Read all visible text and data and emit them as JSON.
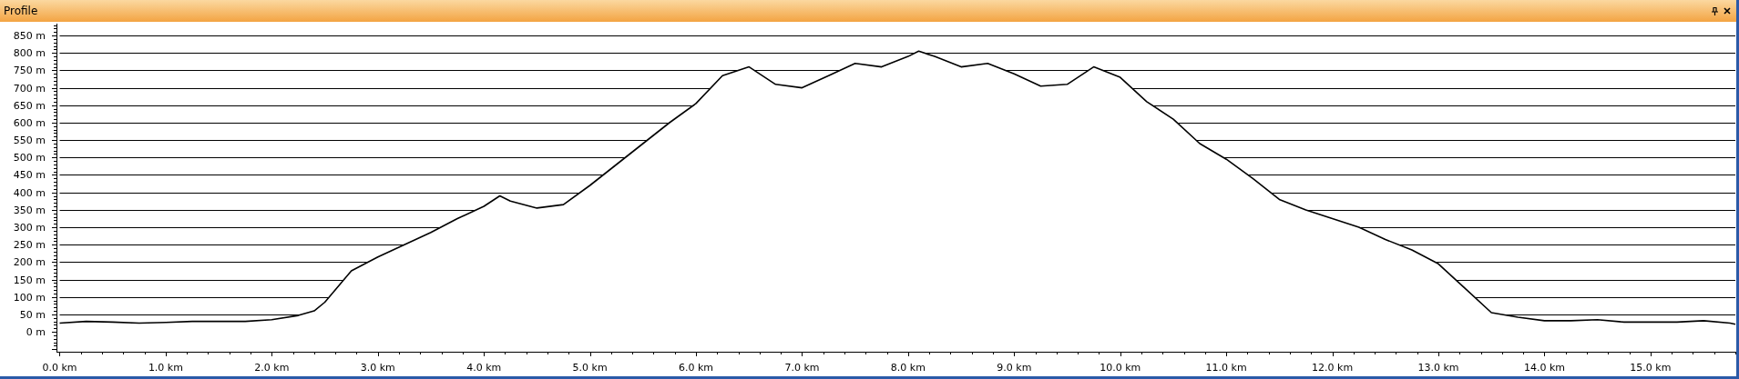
{
  "panel": {
    "title": "Profile"
  },
  "chart": {
    "chart_data": {
      "type": "line",
      "grid": true,
      "xlim": [
        -0.03,
        15.8
      ],
      "ylim": [
        -57,
        884
      ],
      "x": [
        0,
        0.25,
        0.5,
        0.75,
        1,
        1.25,
        1.5,
        1.75,
        2,
        2.25,
        2.4,
        2.5,
        2.75,
        3,
        3.25,
        3.5,
        3.75,
        4,
        4.15,
        4.25,
        4.5,
        4.75,
        5,
        5.25,
        5.5,
        5.75,
        6,
        6.25,
        6.5,
        6.75,
        7,
        7.25,
        7.5,
        7.75,
        8,
        8.1,
        8.25,
        8.5,
        8.75,
        9,
        9.25,
        9.5,
        9.75,
        10,
        10.25,
        10.5,
        10.75,
        11,
        11.25,
        11.5,
        11.75,
        12,
        12.25,
        12.5,
        12.75,
        13,
        13.25,
        13.5,
        13.75,
        14,
        14.25,
        14.5,
        14.75,
        15,
        15.25,
        15.5,
        15.75,
        15.8
      ],
      "series": [
        {
          "color": "#000000",
          "values": [
            25,
            30,
            28,
            25,
            27,
            30,
            30,
            30,
            35,
            47,
            60,
            85,
            175,
            215,
            250,
            285,
            325,
            360,
            390,
            375,
            355,
            365,
            420,
            480,
            540,
            600,
            655,
            735,
            760,
            710,
            700,
            735,
            770,
            760,
            790,
            805,
            790,
            760,
            770,
            740,
            705,
            710,
            760,
            730,
            660,
            610,
            540,
            495,
            440,
            380,
            350,
            325,
            300,
            265,
            235,
            195,
            125,
            55,
            42,
            32,
            32,
            35,
            28,
            28,
            28,
            32,
            25,
            22
          ]
        }
      ],
      "xticks": [
        {
          "value": 0,
          "label": "0.0 km"
        },
        {
          "value": 1,
          "label": "1.0 km"
        },
        {
          "value": 2,
          "label": "2.0 km"
        },
        {
          "value": 3,
          "label": "3.0 km"
        },
        {
          "value": 4,
          "label": "4.0 km"
        },
        {
          "value": 5,
          "label": "5.0 km"
        },
        {
          "value": 6,
          "label": "6.0 km"
        },
        {
          "value": 7,
          "label": "7.0 km"
        },
        {
          "value": 8,
          "label": "8.0 km"
        },
        {
          "value": 9,
          "label": "9.0 km"
        },
        {
          "value": 10,
          "label": "10.0 km"
        },
        {
          "value": 11,
          "label": "11.0 km"
        },
        {
          "value": 12,
          "label": "12.0 km"
        },
        {
          "value": 13,
          "label": "13.0 km"
        },
        {
          "value": 14,
          "label": "14.0 km"
        },
        {
          "value": 15,
          "label": "15.0 km"
        }
      ],
      "yticks": [
        {
          "value": 0,
          "label": "0 m"
        },
        {
          "value": 50,
          "label": "50 m"
        },
        {
          "value": 100,
          "label": "100 m"
        },
        {
          "value": 150,
          "label": "150 m"
        },
        {
          "value": 200,
          "label": "200 m"
        },
        {
          "value": 250,
          "label": "250 m"
        },
        {
          "value": 300,
          "label": "300 m"
        },
        {
          "value": 350,
          "label": "350 m"
        },
        {
          "value": 400,
          "label": "400 m"
        },
        {
          "value": 450,
          "label": "450 m"
        },
        {
          "value": 500,
          "label": "500 m"
        },
        {
          "value": 550,
          "label": "550 m"
        },
        {
          "value": 600,
          "label": "600 m"
        },
        {
          "value": 650,
          "label": "650 m"
        },
        {
          "value": 700,
          "label": "700 m"
        },
        {
          "value": 750,
          "label": "750 m"
        },
        {
          "value": 800,
          "label": "800 m"
        },
        {
          "value": 850,
          "label": "850 m"
        }
      ]
    }
  }
}
